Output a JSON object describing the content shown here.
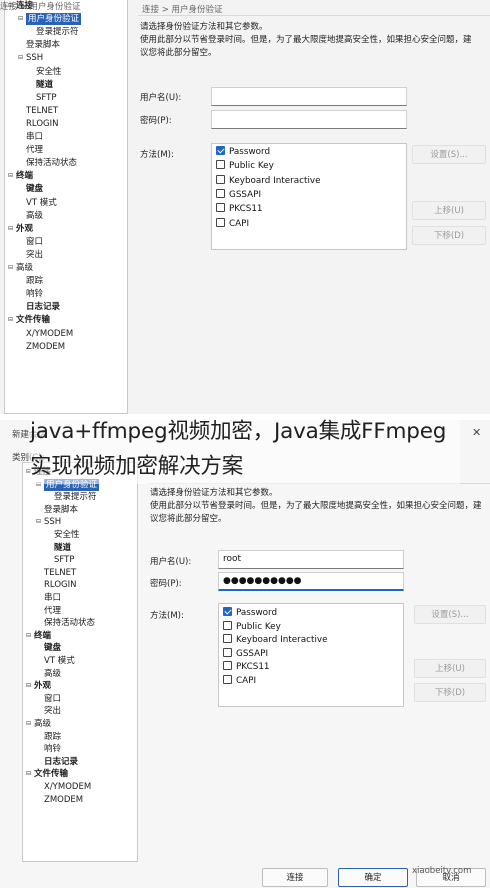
{
  "overlay_title": "java+ffmpeg视频加密，Java集成FFmpeg实现视频加密解决方案",
  "watermark": "xiaobeitv.com",
  "dialog": {
    "title": "新建会话",
    "close": "✕",
    "category_label": "类别(C):"
  },
  "tree": [
    {
      "label": "连接",
      "depth": 0,
      "expand": "minus",
      "bold": true
    },
    {
      "label": "用户身份验证",
      "depth": 1,
      "expand": "minus",
      "selected": true
    },
    {
      "label": "登录提示符",
      "depth": 2
    },
    {
      "label": "登录脚本",
      "depth": 1
    },
    {
      "label": "SSH",
      "depth": 1,
      "expand": "minus"
    },
    {
      "label": "安全性",
      "depth": 2
    },
    {
      "label": "隧道",
      "depth": 2,
      "bold": true
    },
    {
      "label": "SFTP",
      "depth": 2
    },
    {
      "label": "TELNET",
      "depth": 1
    },
    {
      "label": "RLOGIN",
      "depth": 1
    },
    {
      "label": "串口",
      "depth": 1
    },
    {
      "label": "代理",
      "depth": 1
    },
    {
      "label": "保持活动状态",
      "depth": 1
    },
    {
      "label": "终端",
      "depth": 0,
      "expand": "minus",
      "bold": true
    },
    {
      "label": "键盘",
      "depth": 1,
      "bold": true
    },
    {
      "label": "VT 模式",
      "depth": 1
    },
    {
      "label": "高级",
      "depth": 1
    },
    {
      "label": "外观",
      "depth": 0,
      "expand": "minus",
      "bold": true
    },
    {
      "label": "窗口",
      "depth": 1
    },
    {
      "label": "突出",
      "depth": 1
    },
    {
      "label": "高级",
      "depth": 0,
      "expand": "minus"
    },
    {
      "label": "跟踪",
      "depth": 1
    },
    {
      "label": "响铃",
      "depth": 1
    },
    {
      "label": "日志记录",
      "depth": 1,
      "bold": true
    },
    {
      "label": "文件传输",
      "depth": 0,
      "expand": "minus",
      "bold": true
    },
    {
      "label": "X/YMODEM",
      "depth": 1
    },
    {
      "label": "ZMODEM",
      "depth": 1
    }
  ],
  "breadcrumb": "连接 > 用户身份验证",
  "description": {
    "line1": "请选择身份验证方法和其它参数。",
    "line2": "使用此部分以节省登录时间。但是，为了最大限度地提高安全性，如果担心安全问题，建",
    "line3": "议您将此部分留空。"
  },
  "form1": {
    "username_label": "用户名(U):",
    "username_value": "",
    "password_label": "密码(P):",
    "password_value": ""
  },
  "form2": {
    "username_label": "用户名(U):",
    "username_value": "root",
    "password_label": "密码(P):",
    "password_value": "●●●●●●●●●●"
  },
  "method_label": "方法(M):",
  "methods": [
    {
      "label": "Password",
      "checked": true
    },
    {
      "label": "Public Key",
      "checked": false
    },
    {
      "label": "Keyboard Interactive",
      "checked": false
    },
    {
      "label": "GSSAPI",
      "checked": false
    },
    {
      "label": "PKCS11",
      "checked": false
    },
    {
      "label": "CAPI",
      "checked": false
    }
  ],
  "side_buttons": {
    "settings": "设置(S)...",
    "move_up": "上移(U)",
    "move_down": "下移(D)"
  },
  "footer": {
    "connect": "连接",
    "ok": "确定",
    "cancel": "取消"
  },
  "colors": {
    "selection": "#2a63b5",
    "checkbox_on": "#1f66c9"
  }
}
